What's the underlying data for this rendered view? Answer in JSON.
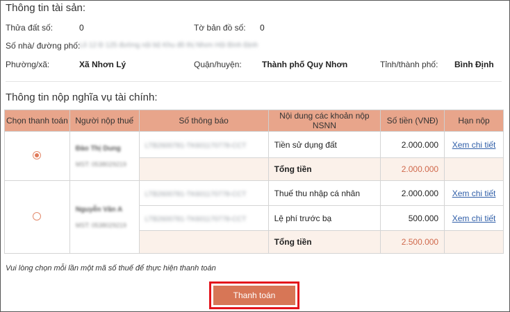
{
  "asset_info": {
    "title": "Thông tin tài sản:",
    "parcel_label": "Thửa đất số:",
    "parcel_value": "0",
    "map_sheet_label": "Tờ bản đồ số:",
    "map_sheet_value": "0",
    "address_label": "Số nhà/ đường phố:",
    "address_value": "Lô 12 Đ 125 đường nội bộ Khu đô thị Nhơn Hội Bình Định",
    "ward_label": "Phường/xã:",
    "ward_value": "Xã Nhơn Lý",
    "district_label": "Quận/huyện:",
    "district_value": "Thành phố Quy Nhơn",
    "province_label": "Tỉnh/thành phố:",
    "province_value": "Bình Định"
  },
  "obligation": {
    "title": "Thông tin nộp nghĩa vụ tài chính:",
    "headers": [
      "Chọn thanh toán",
      "Người nộp thuế",
      "Số thông báo",
      "Nội dung các khoản nộp NSNN",
      "Số tiền (VNĐ)",
      "Hạn nộp"
    ],
    "groups": [
      {
        "selected": true,
        "payer_name": "Đào Thị Dung",
        "payer_id": "MST: 0538029219",
        "items": [
          {
            "notice": "LTB2600781-TK601170778-CCT",
            "content": "Tiền sử dụng đất",
            "amount": "2.000.000",
            "deadline_link": "Xem chi tiết"
          }
        ],
        "total_label": "Tổng tiền",
        "total_amount": "2.000.000"
      },
      {
        "selected": false,
        "payer_name": "Nguyễn Văn A",
        "payer_id": "MST: 0538029219",
        "items": [
          {
            "notice": "LTB2600781-TK601170778-CCT",
            "content": "Thuế thu nhập cá nhân",
            "amount": "2.000.000",
            "deadline_link": "Xem chi tiết"
          },
          {
            "notice": "LTB2600781-TK601170778-CCT",
            "content": "Lệ phí trước bạ",
            "amount": "500.000",
            "deadline_link": "Xem chi tiết"
          }
        ],
        "total_label": "Tổng tiền",
        "total_amount": "2.500.000"
      }
    ]
  },
  "hint": "Vui lòng chọn mỗi lần một mã số thuế để thực hiện thanh toán",
  "pay_button": "Thanh toán",
  "colors": {
    "header_bg": "#e8a58b",
    "accent": "#d77656",
    "highlight_border": "#e3141c",
    "link": "#2f5ea8",
    "total_amount": "#d0694c"
  }
}
